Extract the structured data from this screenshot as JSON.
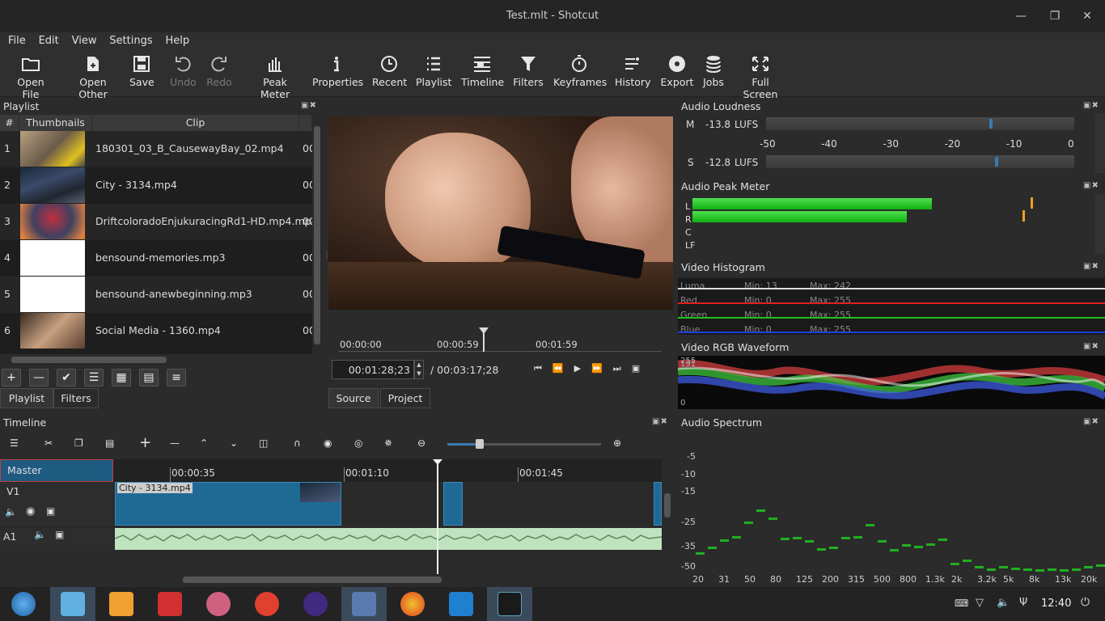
{
  "window": {
    "title": "Test.mlt - Shotcut"
  },
  "menu": [
    "File",
    "Edit",
    "View",
    "Settings",
    "Help"
  ],
  "toolbar": {
    "open_file": "Open File",
    "open_other": "Open Other",
    "save": "Save",
    "undo": "Undo",
    "redo": "Redo",
    "peak_meter": "Peak Meter",
    "properties": "Properties",
    "recent": "Recent",
    "playlist": "Playlist",
    "timeline": "Timeline",
    "filters": "Filters",
    "keyframes": "Keyframes",
    "history": "History",
    "export": "Export",
    "jobs": "Jobs",
    "full_screen": "Full Screen"
  },
  "playlist": {
    "title": "Playlist",
    "columns": [
      "#",
      "Thumbnails",
      "Clip"
    ],
    "rows": [
      {
        "num": "1",
        "clip": "180301_03_B_CausewayBay_02.mp4",
        "dur": "00"
      },
      {
        "num": "2",
        "clip": "City - 3134.mp4",
        "dur": "00"
      },
      {
        "num": "3",
        "clip": "DriftcoloradoEnjukuracingRd1-HD.mp4.mp4",
        "dur": "00"
      },
      {
        "num": "4",
        "clip": "bensound-memories.mp3",
        "dur": "00"
      },
      {
        "num": "5",
        "clip": "bensound-anewbeginning.mp3",
        "dur": "00"
      },
      {
        "num": "6",
        "clip": "Social Media - 1360.mp4",
        "dur": "00"
      }
    ],
    "tabs": {
      "playlist": "Playlist",
      "filters": "Filters"
    }
  },
  "player": {
    "ruler": [
      "00:00:00",
      "00:00:59",
      "00:01:59"
    ],
    "position": "00:01:28;23",
    "duration": "/ 00:03:17;28",
    "tabs": {
      "source": "Source",
      "project": "Project"
    }
  },
  "loudness": {
    "title": "Audio Loudness",
    "m_label": "M",
    "m_value": "-13.8",
    "s_label": "S",
    "s_value": "-12.8",
    "unit": "LUFS",
    "scale": [
      "-50",
      "-40",
      "-30",
      "-20",
      "-10",
      "0"
    ]
  },
  "peak": {
    "title": "Audio Peak Meter",
    "channels": [
      "L",
      "R",
      "C",
      "LF"
    ],
    "l_level": 0.86,
    "r_level": 0.77
  },
  "histogram": {
    "title": "Video Histogram",
    "rows": [
      {
        "name": "Luma",
        "min": "Min: 13",
        "max": "Max: 242",
        "color": "#dddddd"
      },
      {
        "name": "Red",
        "min": "Min: 0",
        "max": "Max: 255",
        "color": "#e02020"
      },
      {
        "name": "Green",
        "min": "Min: 0",
        "max": "Max: 255",
        "color": "#20c020"
      },
      {
        "name": "Blue",
        "min": "Min: 0",
        "max": "Max: 255",
        "color": "#2040e0"
      }
    ]
  },
  "waveform": {
    "title": "Video RGB Waveform",
    "top": "255",
    "mid": "191",
    "bottom": "0"
  },
  "spectrum": {
    "title": "Audio Spectrum",
    "ylabels": [
      "-5",
      "-10",
      "-15",
      "-25",
      "-35",
      "-50"
    ],
    "xlabels": [
      "20",
      "31",
      "50",
      "80",
      "125",
      "200",
      "315",
      "500",
      "800",
      "1.3k",
      "2k",
      "3.2k",
      "5k",
      "8k",
      "13k",
      "20k"
    ]
  },
  "timeline": {
    "title": "Timeline",
    "ruler": [
      "00:00:35",
      "00:01:10",
      "00:01:45"
    ],
    "master": "Master",
    "v1": "V1",
    "a1": "A1",
    "clip": "City - 3134.mp4"
  },
  "taskbar": {
    "clock": "12:40"
  }
}
